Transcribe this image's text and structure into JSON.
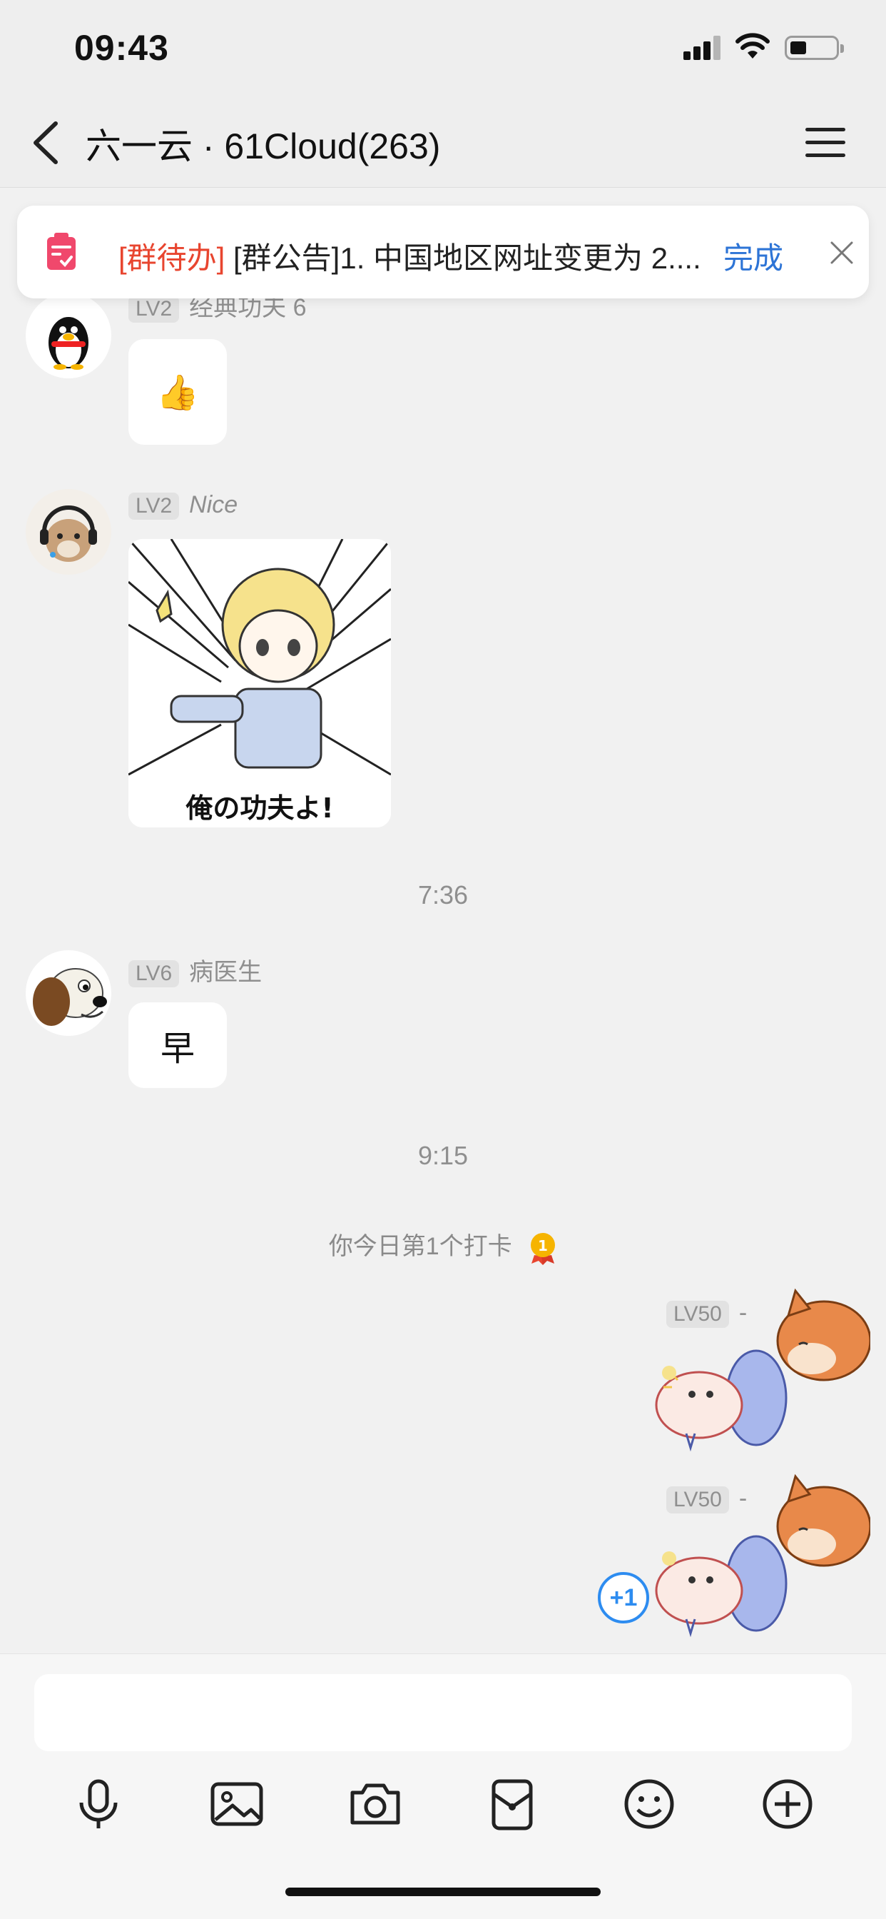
{
  "status_bar": {
    "time": "09:43"
  },
  "nav": {
    "title": "六一云 · 61Cloud(263)"
  },
  "notice": {
    "tag": "[群待办]",
    "text": " [群公告]1. 中国地区网址变更为 2....",
    "done_label": "完成"
  },
  "messages": [
    {
      "level": "LV2",
      "sender": "经典功夫 6",
      "content": "👍",
      "type": "emoji"
    },
    {
      "level": "LV2",
      "sender": "Nice",
      "content": "俺の功夫よ!",
      "type": "sticker"
    },
    {
      "time_separator": "7:36"
    },
    {
      "level": "LV6",
      "sender": "病医生",
      "content": "早",
      "type": "text"
    },
    {
      "time_separator": "9:15"
    },
    {
      "system": "你今日第1个打卡"
    },
    {
      "level": "LV50",
      "sender": "-",
      "type": "sticker",
      "self": true
    },
    {
      "level": "LV50",
      "sender": "-",
      "type": "sticker",
      "self": true,
      "plus_one": "+1"
    }
  ],
  "colors": {
    "accent_blue": "#2d74d6",
    "notice_red": "#e8452f",
    "background": "#f1f1f1"
  },
  "toolbar": {
    "icons": [
      "microphone-icon",
      "image-icon",
      "camera-icon",
      "red-packet-icon",
      "emoji-icon",
      "plus-icon"
    ]
  }
}
